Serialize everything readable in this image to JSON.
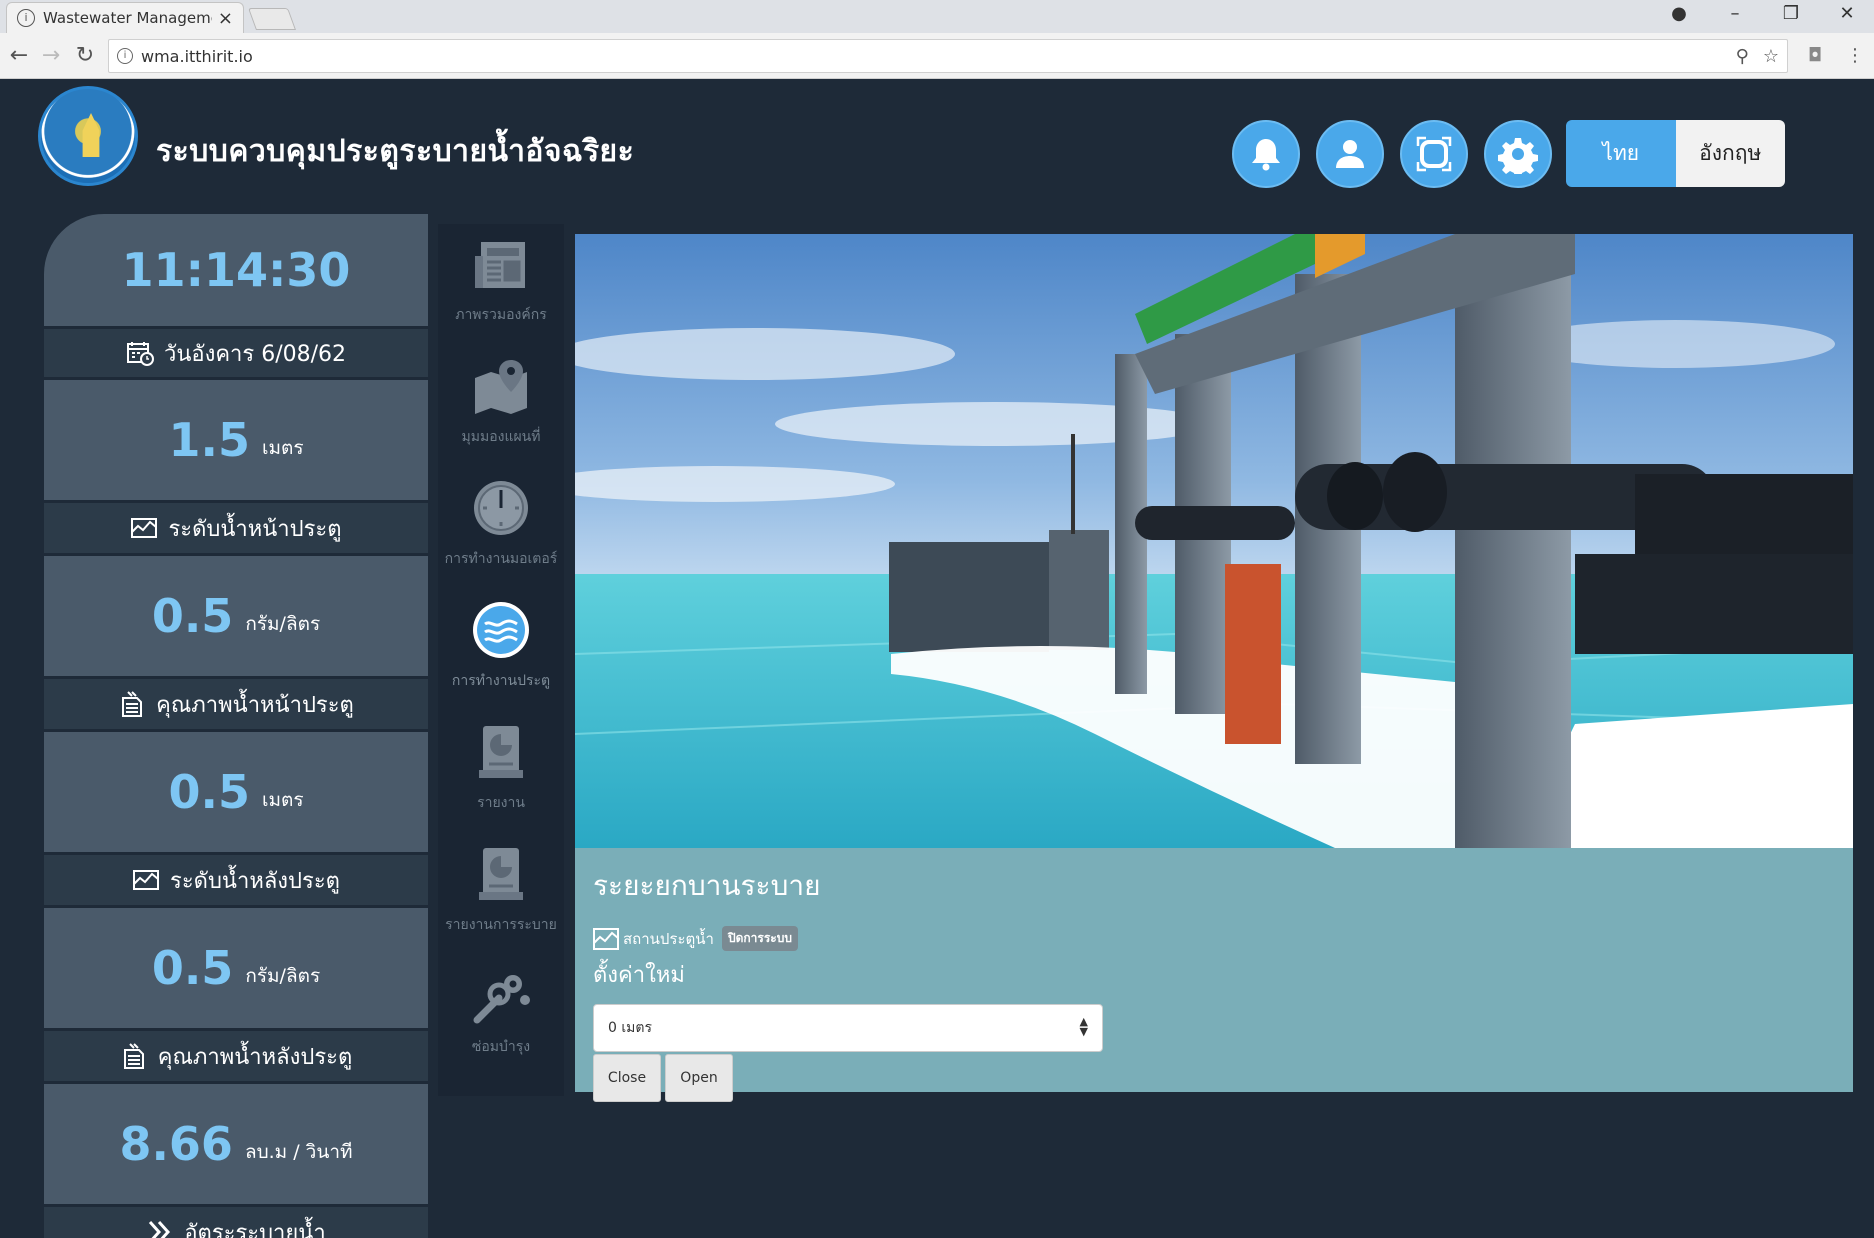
{
  "browser": {
    "tab_title": "Wastewater Managemen",
    "tab_close": "×",
    "url": "wma.itthirit.io",
    "window_controls": {
      "minimize": "–",
      "restore": "❐",
      "close": "✕"
    }
  },
  "header": {
    "app_title": "ระบบควบคุมประตูระบายน้ำอัจฉริยะ",
    "buttons": [
      "bell-icon",
      "user-icon",
      "fullscreen-icon",
      "gear-icon"
    ],
    "lang_thai": "ไทย",
    "lang_english": "อังกฤษ",
    "lang_selected": "ไทย"
  },
  "status": {
    "time": "11:14:30",
    "date": "วันอังคาร 6/08/62",
    "metrics": [
      {
        "value": "1.5",
        "unit": "เมตร",
        "label": "ระดับน้ำหน้าประตู",
        "icon": "water-level-icon"
      },
      {
        "value": "0.5",
        "unit": "กรัม/ลิตร",
        "label": "คุณภาพน้ำหน้าประตู",
        "icon": "water-quality-icon"
      },
      {
        "value": "0.5",
        "unit": "เมตร",
        "label": "ระดับน้ำหลังประตู",
        "icon": "water-level-icon"
      },
      {
        "value": "0.5",
        "unit": "กรัม/ลิตร",
        "label": "คุณภาพน้ำหลังประตู",
        "icon": "water-quality-icon"
      },
      {
        "value": "8.66",
        "unit": "ลบ.ม / วินาที",
        "label": "อัตระระบายน้ำ",
        "icon": "flow-rate-icon"
      }
    ]
  },
  "menu": {
    "items": [
      {
        "label": "ภาพรวมองค์กร",
        "icon": "newspaper-icon"
      },
      {
        "label": "มุมมองแผนที่",
        "icon": "map-pin-icon"
      },
      {
        "label": "การทำงานมอเตอร์",
        "icon": "gauge-icon"
      },
      {
        "label": "การทำงานประตู",
        "icon": "water-waves-icon",
        "active": true
      },
      {
        "label": "รายงาน",
        "icon": "report-icon"
      },
      {
        "label": "รายงานการระบาย",
        "icon": "report-icon"
      },
      {
        "label": "ซ่อมบำรุง",
        "icon": "wrench-gear-icon"
      }
    ]
  },
  "control": {
    "title": "ระยะยกบานระบาย",
    "status_label": "สถานประตูน้ำ",
    "status_badge": "ปิดการระบบ",
    "set_new_label": "ตั้งค่าใหม่",
    "select_value": "0 เมตร",
    "close_button": "Close",
    "open_button": "Open"
  },
  "colors": {
    "background": "#1e2a38",
    "panel": "#4a5a6a",
    "panel_dark": "#2c3b49",
    "accent": "#4aa8ea",
    "value_text": "#7ec6f3",
    "control_panel": "#7aaeb8"
  }
}
